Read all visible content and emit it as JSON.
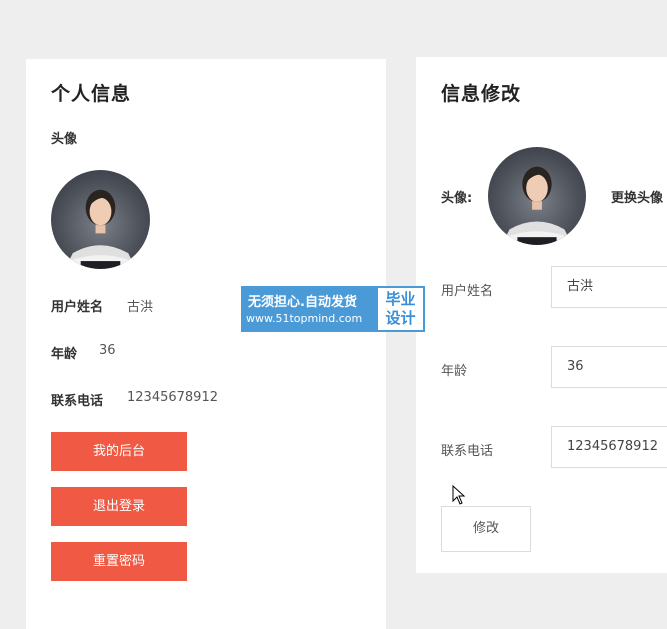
{
  "profile": {
    "title": "个人信息",
    "avatar_label": "头像",
    "username_label": "用户姓名",
    "username_value": "古洪",
    "age_label": "年龄",
    "age_value": "36",
    "phone_label": "联系电话",
    "phone_value": "12345678912",
    "buttons": {
      "dashboard": "我的后台",
      "logout": "退出登录",
      "reset_password": "重置密码"
    }
  },
  "edit": {
    "title": "信息修改",
    "avatar_label": "头像:",
    "change_avatar": "更换头像",
    "username_label": "用户姓名",
    "username_value": "古洪",
    "age_label": "年龄",
    "age_value": "36",
    "phone_label": "联系电话",
    "phone_value": "12345678912",
    "submit": "修改"
  },
  "watermark": {
    "line1": "无须担心.自动发货",
    "line2": "www.51topmind.com",
    "badge_line1": "毕业",
    "badge_line2": "设计"
  },
  "colors": {
    "accent": "#f05a44",
    "background": "#eeeeee",
    "watermark": "#4a9ad8"
  }
}
